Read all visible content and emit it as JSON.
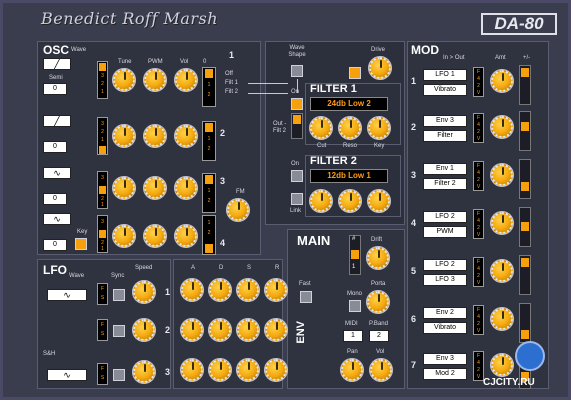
{
  "brand": {
    "signature": "Benedict Roff Marsh",
    "model": "DA-80"
  },
  "osc": {
    "title": "OSC",
    "wave_label": "Wave",
    "semi_label": "Semi",
    "key_label": "Key",
    "tune": "Tune",
    "pwm": "PWM",
    "vol": "Vol",
    "zero": "0",
    "row_nums": [
      "1",
      "2",
      "3",
      "4"
    ],
    "fm": "FM",
    "off": "Off",
    "filt1": "Filt 1",
    "filt2": "Filt 2",
    "semi_values": [
      "0",
      "0",
      "0",
      "0"
    ],
    "stepper": [
      "3",
      "2",
      "1"
    ],
    "mini_12": [
      "1",
      "2"
    ]
  },
  "filter": {
    "waveshape": "Wave Shape",
    "drive": "Drive",
    "f1_title": "FILTER 1",
    "f1_type": "24db Low 2",
    "f2_title": "FILTER 2",
    "f2_type": "12db Low 1",
    "on": "On",
    "cut": "Cut",
    "reso": "Reso",
    "key": "Key",
    "link": "Link",
    "out_filt2": "Out - Filt 2"
  },
  "main": {
    "title": "MAIN",
    "drift": "Drift",
    "mono": "Mono",
    "portam": "Porta",
    "midi": "MIDI",
    "pband": "P.Band",
    "midi_val": "1",
    "pband_val": "2",
    "pan": "Pan",
    "vol": "Vol",
    "voices_top": "#",
    "voices_bot": "1"
  },
  "lfo": {
    "title": "LFO",
    "wave": "Wave",
    "sync": "Sync",
    "speed": "Speed",
    "sh": "S&H",
    "nums": [
      "1",
      "2",
      "3"
    ],
    "fs": [
      "F",
      "S"
    ]
  },
  "env": {
    "title": "ENV",
    "a": "A",
    "d": "D",
    "s": "S",
    "r": "R",
    "fast": "Fast",
    "nums": [
      "1",
      "2",
      "3"
    ]
  },
  "mod": {
    "title": "MOD",
    "inout": "In > Out",
    "amt": "Amt",
    "pm": "+/-",
    "nums": [
      "1",
      "2",
      "3",
      "4",
      "5",
      "6",
      "7"
    ],
    "ins": [
      "LFO 1",
      "Env 3",
      "Env 1",
      "LFO 2",
      "LFO 2",
      "Env 2",
      "Env 3"
    ],
    "outs": [
      "Vibrato",
      "Filter",
      "Filter 2",
      "PWM",
      "LFO 3",
      "Vibrato",
      "Mod 2"
    ],
    "fletters": [
      "F",
      "4",
      "2",
      "V"
    ]
  },
  "watermark": "CJCITY.RU",
  "colors": {
    "panel": "#3a3d4e",
    "knob": "#f4a90f",
    "display": "#ff9b1a",
    "button_on": "#f5a00c"
  }
}
